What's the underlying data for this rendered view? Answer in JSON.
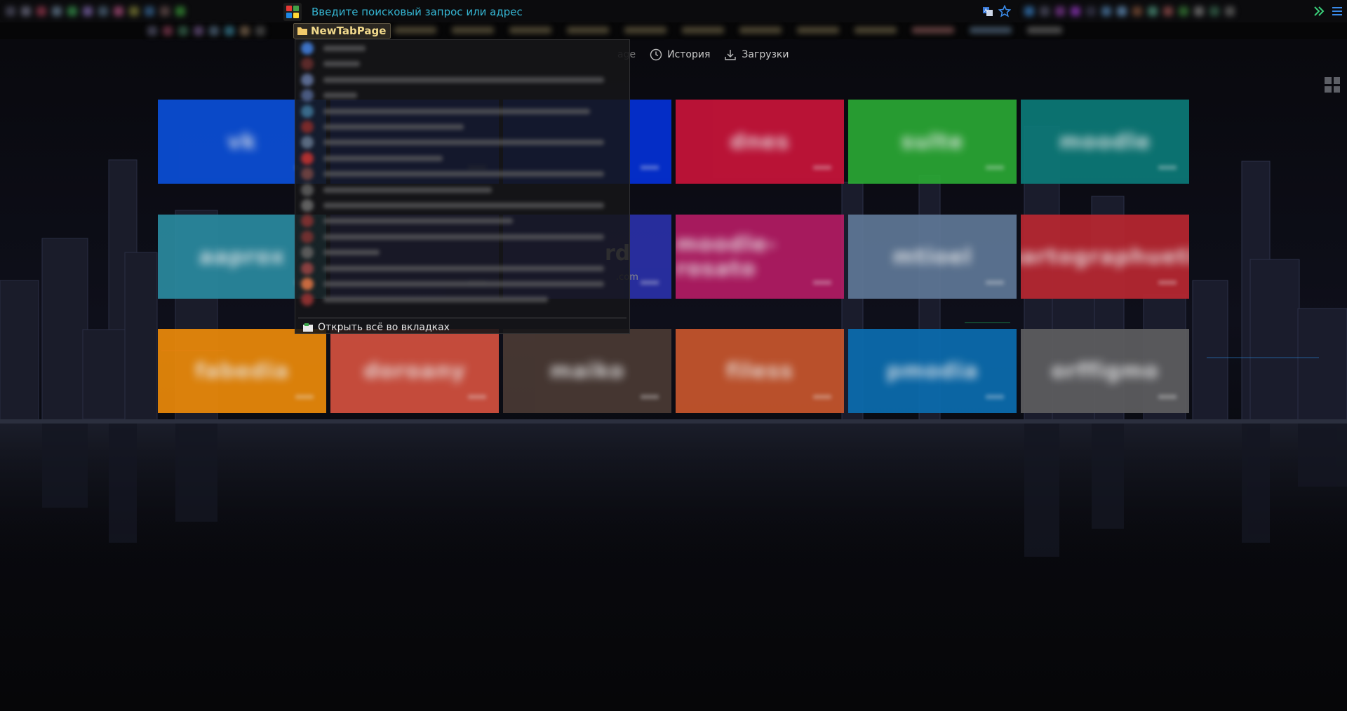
{
  "toolbar": {
    "url_placeholder": "Введите поисковый запрос или адрес"
  },
  "bookmarks_bar": {
    "folder_label": "NewTabPage"
  },
  "ntp": {
    "partial_link_text": "age",
    "history_label": "История",
    "downloads_label": "Загрузки",
    "faded_text": "rd",
    "faded_text_small": ".com"
  },
  "tiles": [
    {
      "label": "vk",
      "color": "#0b4fd8"
    },
    {
      "label": "",
      "color": "#0b2fc8"
    },
    {
      "label": "",
      "color": "#0430d6"
    },
    {
      "label": "dnes",
      "color": "#c8143a"
    },
    {
      "label": "sulte",
      "color": "#2aa834"
    },
    {
      "label": "moodle",
      "color": "#0c7a78"
    },
    {
      "label": "aaprox",
      "color": "#2a8aa0"
    },
    {
      "label": "",
      "color": "#2b2f9a"
    },
    {
      "label": "",
      "color": "#2a30a8"
    },
    {
      "label": "moodle-rosato",
      "color": "#b41c64"
    },
    {
      "label": "mtioel",
      "color": "#5f7897"
    },
    {
      "label": "martographuetin",
      "color": "#b92731"
    },
    {
      "label": "fabedia",
      "color": "#ec8a0a"
    },
    {
      "label": "doroany",
      "color": "#d4513f"
    },
    {
      "label": "maiko",
      "color": "#4a3a34"
    },
    {
      "label": "filess",
      "color": "#c8562d"
    },
    {
      "label": "pmodia",
      "color": "#0b6db0"
    },
    {
      "label": "orffigmo",
      "color": "#5e5e60"
    }
  ],
  "dropdown": {
    "open_all_label": "Открыть всё во вкладках",
    "item_favicon_colors": [
      "#3d73c7",
      "#5b2a2a",
      "#5a6a90",
      "#4a5a80",
      "#3a6a8a",
      "#7a2a2a",
      "#5a6a80",
      "#b03030",
      "#6a4040",
      "#555555",
      "#606060",
      "#7a3030",
      "#703030",
      "#5a5a5a",
      "#8a4040",
      "#c86a40",
      "#8a3030"
    ]
  },
  "colors": {
    "url_text": "#35b6d3",
    "bookmark_folder_text": "#f1d98c",
    "accent_icon": "#3a7ad8"
  }
}
